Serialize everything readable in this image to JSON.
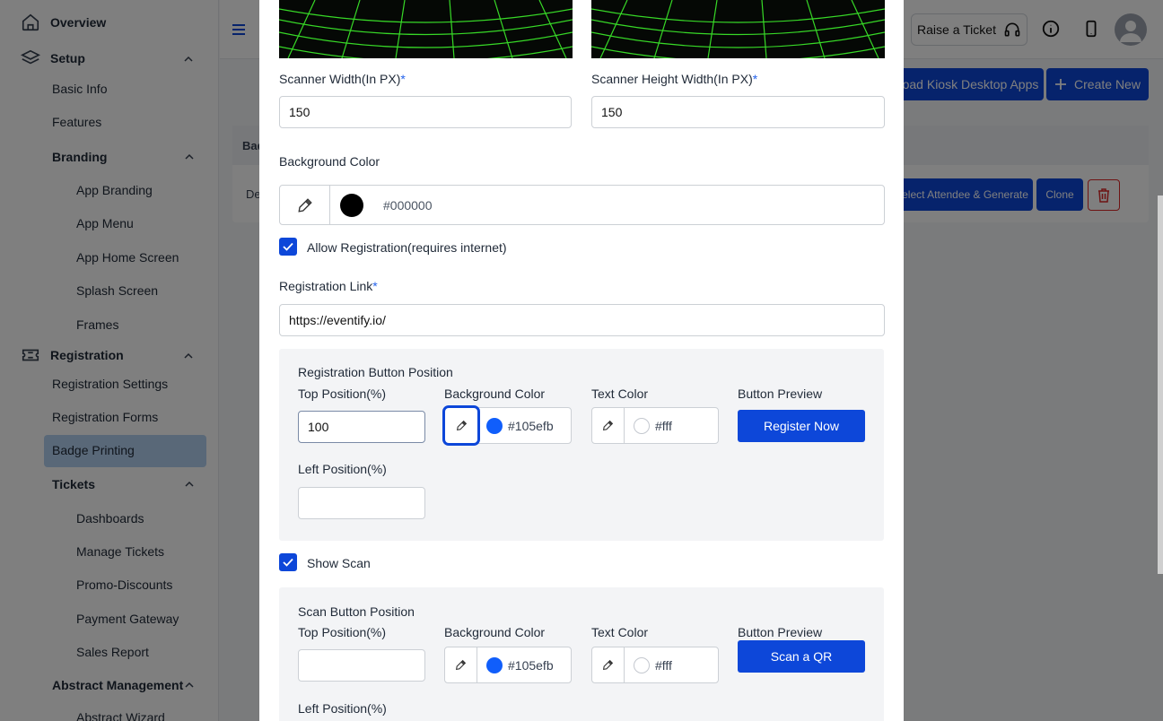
{
  "sidebar": {
    "overview": "Overview",
    "setup": "Setup",
    "basic_info": "Basic Info",
    "features": "Features",
    "branding": "Branding",
    "app_branding": "App Branding",
    "app_menu": "App Menu",
    "app_home_screen": "App Home Screen",
    "splash_screen": "Splash Screen",
    "frames": "Frames",
    "registration": "Registration",
    "registration_settings": "Registration Settings",
    "registration_forms": "Registration Forms",
    "badge_printing": "Badge Printing",
    "tickets": "Tickets",
    "dashboards": "Dashboards",
    "manage_tickets": "Manage Tickets",
    "promo_discounts": "Promo-Discounts",
    "payment_gateway": "Payment Gateway",
    "sales_report": "Sales Report",
    "abstract_management": "Abstract Management",
    "abstract_wizard": "Abstract Wizard"
  },
  "topbar": {
    "raise_ticket": "Raise a Ticket"
  },
  "page": {
    "download_kiosk": "oad Kiosk Desktop Apps",
    "create_new": "Create New",
    "table_header": "Bad",
    "row_name": "De",
    "select_attendee": "elect Attendee & Generate",
    "clone": "Clone"
  },
  "modal": {
    "scanner_width_label": "Scanner Width(In PX)",
    "scanner_width_value": "150",
    "scanner_height_label": "Scanner Height Width(In PX)",
    "scanner_height_value": "150",
    "required_mark": "*",
    "background_color_label": "Background Color",
    "background_color_value": "#000000",
    "allow_registration_label": "Allow Registration(requires internet)",
    "registration_link_label": "Registration Link",
    "registration_link_value": "https://eventify.io/",
    "reg_button": {
      "title": "Registration Button Position",
      "top_label": "Top Position(%)",
      "top_value": "100",
      "bg_label": "Background Color",
      "bg_value": "#105efb",
      "text_label": "Text Color",
      "text_value": "#fff",
      "preview_label": "Button Preview",
      "preview_text": "Register Now",
      "left_label": "Left Position(%)",
      "left_value": ""
    },
    "show_scan_label": "Show Scan",
    "scan_button": {
      "title": "Scan Button Position",
      "top_label": "Top Position(%)",
      "top_value": "",
      "bg_label": "Background Color",
      "bg_value": "#105efb",
      "text_label": "Text Color",
      "text_value": "#fff",
      "preview_label": "Button Preview",
      "preview_text": "Scan a QR",
      "left_label": "Left Position(%)"
    }
  },
  "colors": {
    "accent": "#0d47d9",
    "swatch_blue": "#105efb",
    "swatch_black": "#000000",
    "swatch_white": "#ffffff"
  }
}
